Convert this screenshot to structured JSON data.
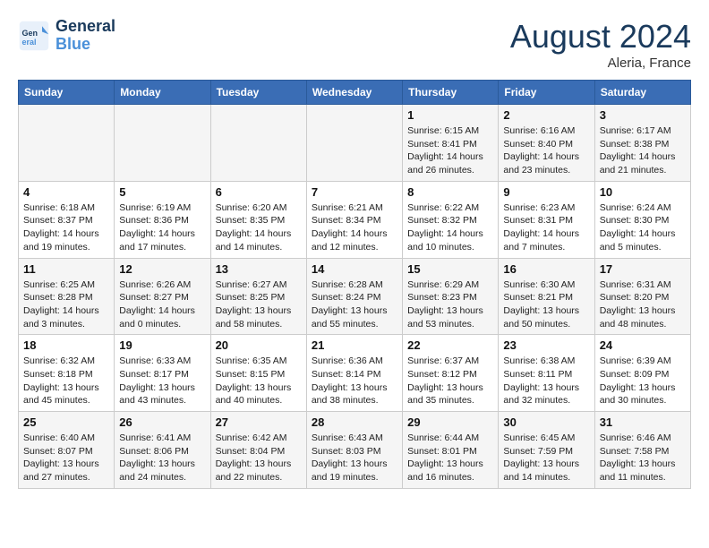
{
  "header": {
    "logo_line1": "General",
    "logo_line2": "Blue",
    "month_title": "August 2024",
    "location": "Aleria, France"
  },
  "days_of_week": [
    "Sunday",
    "Monday",
    "Tuesday",
    "Wednesday",
    "Thursday",
    "Friday",
    "Saturday"
  ],
  "weeks": [
    [
      {
        "day": "",
        "info": ""
      },
      {
        "day": "",
        "info": ""
      },
      {
        "day": "",
        "info": ""
      },
      {
        "day": "",
        "info": ""
      },
      {
        "day": "1",
        "info": "Sunrise: 6:15 AM\nSunset: 8:41 PM\nDaylight: 14 hours\nand 26 minutes."
      },
      {
        "day": "2",
        "info": "Sunrise: 6:16 AM\nSunset: 8:40 PM\nDaylight: 14 hours\nand 23 minutes."
      },
      {
        "day": "3",
        "info": "Sunrise: 6:17 AM\nSunset: 8:38 PM\nDaylight: 14 hours\nand 21 minutes."
      }
    ],
    [
      {
        "day": "4",
        "info": "Sunrise: 6:18 AM\nSunset: 8:37 PM\nDaylight: 14 hours\nand 19 minutes."
      },
      {
        "day": "5",
        "info": "Sunrise: 6:19 AM\nSunset: 8:36 PM\nDaylight: 14 hours\nand 17 minutes."
      },
      {
        "day": "6",
        "info": "Sunrise: 6:20 AM\nSunset: 8:35 PM\nDaylight: 14 hours\nand 14 minutes."
      },
      {
        "day": "7",
        "info": "Sunrise: 6:21 AM\nSunset: 8:34 PM\nDaylight: 14 hours\nand 12 minutes."
      },
      {
        "day": "8",
        "info": "Sunrise: 6:22 AM\nSunset: 8:32 PM\nDaylight: 14 hours\nand 10 minutes."
      },
      {
        "day": "9",
        "info": "Sunrise: 6:23 AM\nSunset: 8:31 PM\nDaylight: 14 hours\nand 7 minutes."
      },
      {
        "day": "10",
        "info": "Sunrise: 6:24 AM\nSunset: 8:30 PM\nDaylight: 14 hours\nand 5 minutes."
      }
    ],
    [
      {
        "day": "11",
        "info": "Sunrise: 6:25 AM\nSunset: 8:28 PM\nDaylight: 14 hours\nand 3 minutes."
      },
      {
        "day": "12",
        "info": "Sunrise: 6:26 AM\nSunset: 8:27 PM\nDaylight: 14 hours\nand 0 minutes."
      },
      {
        "day": "13",
        "info": "Sunrise: 6:27 AM\nSunset: 8:25 PM\nDaylight: 13 hours\nand 58 minutes."
      },
      {
        "day": "14",
        "info": "Sunrise: 6:28 AM\nSunset: 8:24 PM\nDaylight: 13 hours\nand 55 minutes."
      },
      {
        "day": "15",
        "info": "Sunrise: 6:29 AM\nSunset: 8:23 PM\nDaylight: 13 hours\nand 53 minutes."
      },
      {
        "day": "16",
        "info": "Sunrise: 6:30 AM\nSunset: 8:21 PM\nDaylight: 13 hours\nand 50 minutes."
      },
      {
        "day": "17",
        "info": "Sunrise: 6:31 AM\nSunset: 8:20 PM\nDaylight: 13 hours\nand 48 minutes."
      }
    ],
    [
      {
        "day": "18",
        "info": "Sunrise: 6:32 AM\nSunset: 8:18 PM\nDaylight: 13 hours\nand 45 minutes."
      },
      {
        "day": "19",
        "info": "Sunrise: 6:33 AM\nSunset: 8:17 PM\nDaylight: 13 hours\nand 43 minutes."
      },
      {
        "day": "20",
        "info": "Sunrise: 6:35 AM\nSunset: 8:15 PM\nDaylight: 13 hours\nand 40 minutes."
      },
      {
        "day": "21",
        "info": "Sunrise: 6:36 AM\nSunset: 8:14 PM\nDaylight: 13 hours\nand 38 minutes."
      },
      {
        "day": "22",
        "info": "Sunrise: 6:37 AM\nSunset: 8:12 PM\nDaylight: 13 hours\nand 35 minutes."
      },
      {
        "day": "23",
        "info": "Sunrise: 6:38 AM\nSunset: 8:11 PM\nDaylight: 13 hours\nand 32 minutes."
      },
      {
        "day": "24",
        "info": "Sunrise: 6:39 AM\nSunset: 8:09 PM\nDaylight: 13 hours\nand 30 minutes."
      }
    ],
    [
      {
        "day": "25",
        "info": "Sunrise: 6:40 AM\nSunset: 8:07 PM\nDaylight: 13 hours\nand 27 minutes."
      },
      {
        "day": "26",
        "info": "Sunrise: 6:41 AM\nSunset: 8:06 PM\nDaylight: 13 hours\nand 24 minutes."
      },
      {
        "day": "27",
        "info": "Sunrise: 6:42 AM\nSunset: 8:04 PM\nDaylight: 13 hours\nand 22 minutes."
      },
      {
        "day": "28",
        "info": "Sunrise: 6:43 AM\nSunset: 8:03 PM\nDaylight: 13 hours\nand 19 minutes."
      },
      {
        "day": "29",
        "info": "Sunrise: 6:44 AM\nSunset: 8:01 PM\nDaylight: 13 hours\nand 16 minutes."
      },
      {
        "day": "30",
        "info": "Sunrise: 6:45 AM\nSunset: 7:59 PM\nDaylight: 13 hours\nand 14 minutes."
      },
      {
        "day": "31",
        "info": "Sunrise: 6:46 AM\nSunset: 7:58 PM\nDaylight: 13 hours\nand 11 minutes."
      }
    ]
  ]
}
